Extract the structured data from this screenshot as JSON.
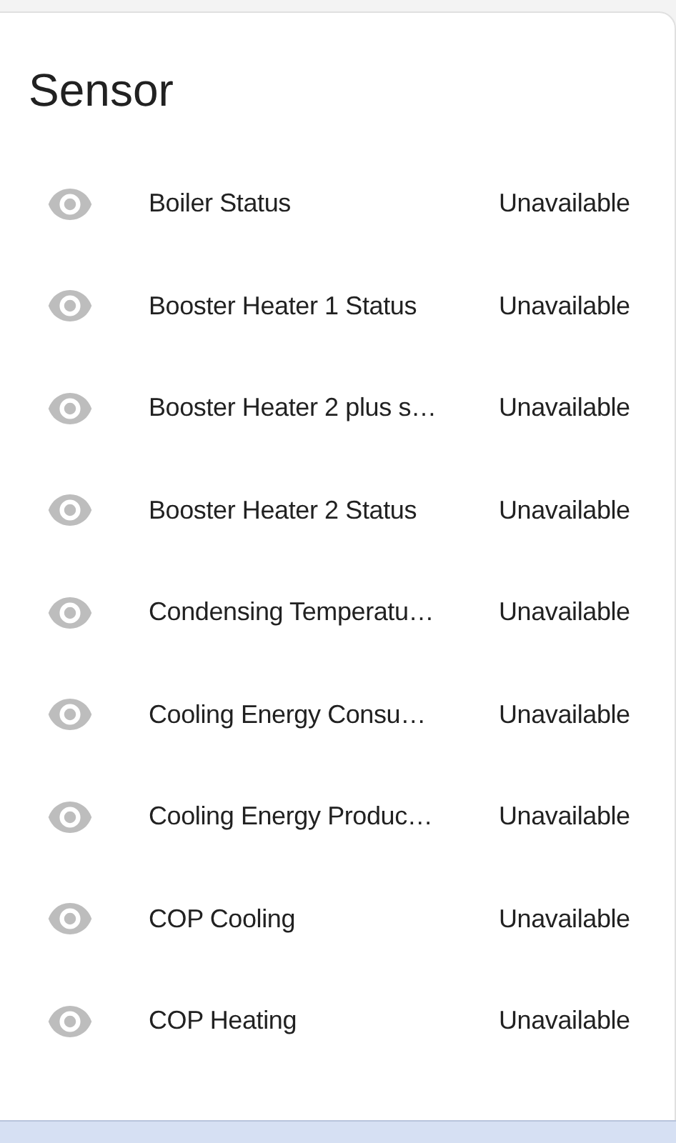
{
  "card": {
    "title": "Sensor"
  },
  "rows": [
    {
      "name": "Boiler Status",
      "value": "Unavailable"
    },
    {
      "name": "Booster Heater 1 Status",
      "value": "Unavailable"
    },
    {
      "name": "Booster Heater 2 plus s…",
      "value": "Unavailable"
    },
    {
      "name": "Booster Heater 2 Status",
      "value": "Unavailable"
    },
    {
      "name": "Condensing Temperatu…",
      "value": "Unavailable"
    },
    {
      "name": "Cooling Energy Consu…",
      "value": "Unavailable"
    },
    {
      "name": "Cooling Energy Produc…",
      "value": "Unavailable"
    },
    {
      "name": "COP Cooling",
      "value": "Unavailable"
    },
    {
      "name": "COP Heating",
      "value": "Unavailable"
    }
  ]
}
